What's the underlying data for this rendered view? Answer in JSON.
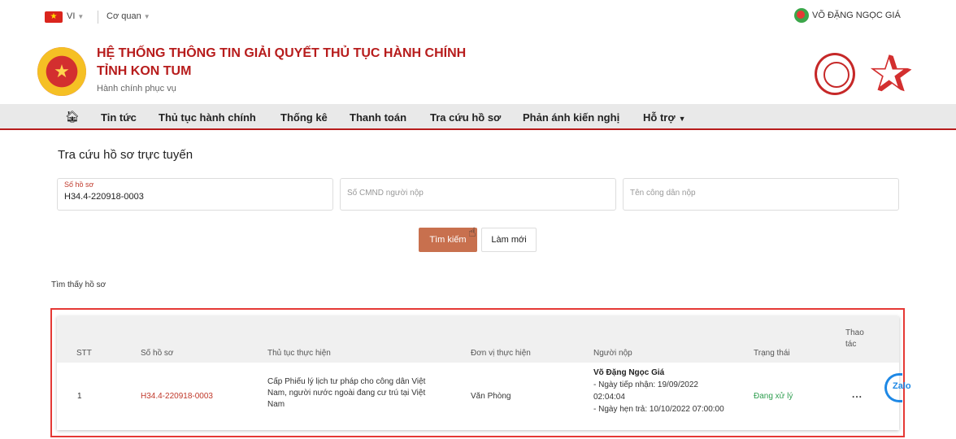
{
  "topbar": {
    "lang": "VI",
    "org": "Cơ quan",
    "user": "VÕ ĐẶNG NGỌC GIÁ"
  },
  "header": {
    "title": "HỆ THỐNG THÔNG TIN GIẢI QUYẾT THỦ TỤC HÀNH CHÍNH",
    "subtitle": "TỈNH KON TUM",
    "tagline": "Hành chính phục vụ"
  },
  "nav": {
    "items": [
      "Tin tức",
      "Thủ tục hành chính",
      "Thống kê",
      "Thanh toán",
      "Tra cứu hồ sơ",
      "Phản ánh kiến nghị",
      "Hỗ trợ"
    ]
  },
  "page": {
    "title": "Tra cứu hồ sơ trực tuyến",
    "file_label": "Số hồ sơ",
    "file_value": "H34.4-220918-0003",
    "id_placeholder": "Số CMND người nộp",
    "name_placeholder": "Tên công dân nộp",
    "search_label": "Tìm kiếm",
    "reset_label": "Làm mới",
    "found_text": "Tìm thấy hồ sơ"
  },
  "table": {
    "headers": [
      "STT",
      "Số hồ sơ",
      "Thủ tục thực hiện",
      "Đơn vị thực hiện",
      "Người nộp",
      "Trạng thái",
      "Thao",
      "tác"
    ],
    "row": {
      "stt": "1",
      "file": "H34.4-220918-0003",
      "procedure": [
        "Cấp Phiếu lý lịch tư pháp cho công dân Việt",
        "Nam, người nước ngoài đang cư trú tại Việt",
        "Nam"
      ],
      "unit": "Văn Phòng",
      "submitter_name": "Võ Đặng Ngọc Giá",
      "received": "- Ngày tiếp nhận: 19/09/2022",
      "received_time": "02:04:04",
      "due": "- Ngày hẹn trả: 10/10/2022 07:00:00",
      "status": "Đang xử lý",
      "actions": "..."
    }
  },
  "zalo": {
    "label": "Zalo"
  },
  "colors": {
    "brand_red": "#b71c1c",
    "search_button": "#c8704e",
    "status_green": "#2e9e4f",
    "highlight_border": "#e53935"
  }
}
